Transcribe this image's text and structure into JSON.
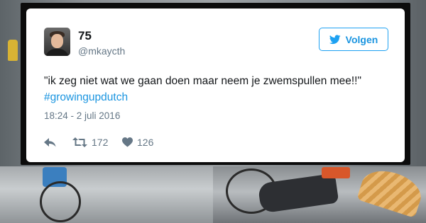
{
  "tweet": {
    "display_name": "75",
    "handle": "@mkaycth",
    "follow_label": "Volgen",
    "text_main": "\"ik zeg niet wat we gaan doen maar neem je zwemspullen mee!!\" ",
    "hashtag": "#growingupdutch",
    "timestamp": "18:24 - 2 juli 2016",
    "retweet_count": "172",
    "like_count": "126"
  },
  "icons": {
    "follow": "twitter-bird-icon",
    "reply": "reply-icon",
    "retweet": "retweet-icon",
    "like": "heart-icon"
  },
  "colors": {
    "accent": "#1da1f2",
    "link": "#1b95e0",
    "text": "#14171a",
    "muted": "#657786"
  }
}
